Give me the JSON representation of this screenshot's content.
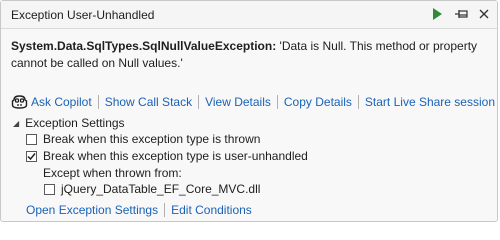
{
  "window": {
    "title": "Exception User-Unhandled",
    "continue_icon": "play-icon",
    "pin_icon": "pin-icon",
    "close_icon": "close-icon"
  },
  "message": {
    "exception_type": "System.Data.SqlTypes.SqlNullValueException:",
    "text": " 'Data is Null. This method or property cannot be called on Null values.'"
  },
  "actions": {
    "ask_copilot": "Ask Copilot",
    "show_call_stack": "Show Call Stack",
    "view_details": "View Details",
    "copy_details": "Copy Details",
    "start_live_share": "Start Live Share session"
  },
  "settings": {
    "header": "Exception Settings",
    "break_thrown": {
      "label": "Break when this exception type is thrown",
      "checked": false
    },
    "break_unhandled": {
      "label": "Break when this exception type is user-unhandled",
      "checked": true
    },
    "except_label": "Except when thrown from:",
    "module": {
      "label": "jQuery_DataTable_EF_Core_MVC.dll",
      "checked": false
    }
  },
  "footer": {
    "open_settings": "Open Exception Settings",
    "edit_conditions": "Edit Conditions"
  },
  "colors": {
    "link": "#1a62b8",
    "play": "#2e8b3a"
  }
}
